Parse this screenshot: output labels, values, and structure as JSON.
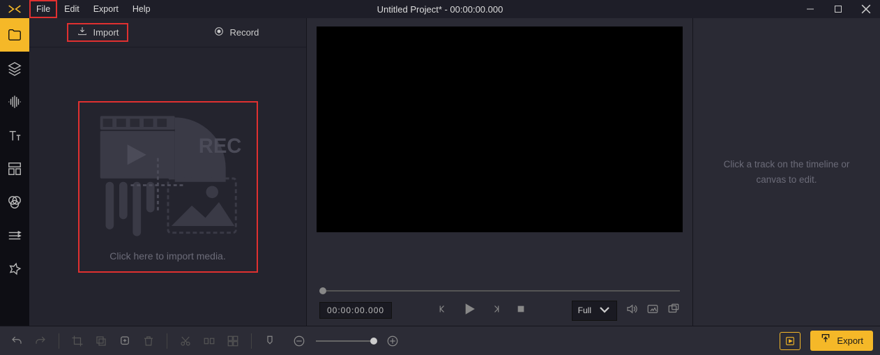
{
  "title": "Untitled Project* - 00:00:00.000",
  "menu": {
    "file": "File",
    "edit": "Edit",
    "export": "Export",
    "help": "Help"
  },
  "mediatabs": {
    "import": "Import",
    "record": "Record"
  },
  "dropzone": {
    "hint": "Click here to import media.",
    "rec": "REC"
  },
  "preview": {
    "timecode": "00:00:00.000",
    "zoom": {
      "label": "Full"
    }
  },
  "properties": {
    "hint_line1": "Click a track on the timeline or",
    "hint_line2": "canvas to edit."
  },
  "bottombar": {
    "export": "Export"
  }
}
